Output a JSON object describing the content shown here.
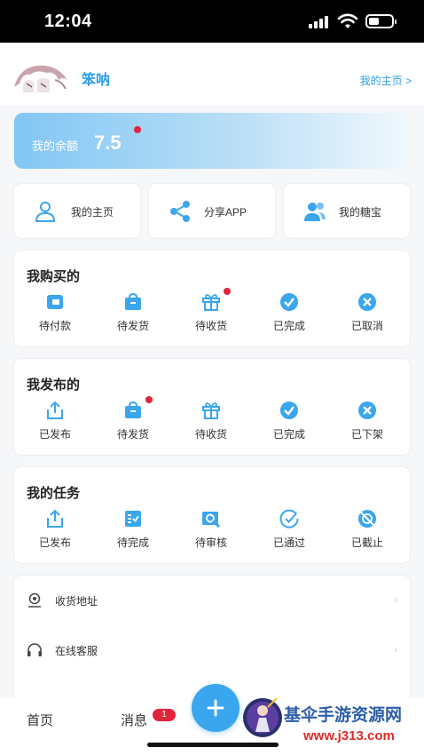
{
  "status_bar": {
    "time": "12:04"
  },
  "profile": {
    "username": "笨呐",
    "home_link": "我的主页 >"
  },
  "balance": {
    "label": "我的余额",
    "value": "7.5"
  },
  "quick_actions": [
    {
      "label": "我的主页",
      "icon": "user-icon"
    },
    {
      "label": "分享APP",
      "icon": "share-icon"
    },
    {
      "label": "我的糖宝",
      "icon": "group-icon"
    }
  ],
  "purchased": {
    "title": "我购买的",
    "items": [
      {
        "label": "待付款",
        "icon": "wallet-icon"
      },
      {
        "label": "待发货",
        "icon": "bag-icon"
      },
      {
        "label": "待收货",
        "icon": "gift-icon"
      },
      {
        "label": "已完成",
        "icon": "check-circle-icon"
      },
      {
        "label": "已取消",
        "icon": "x-circle-icon"
      }
    ]
  },
  "published": {
    "title": "我发布的",
    "items": [
      {
        "label": "已发布",
        "icon": "upload-icon"
      },
      {
        "label": "待发货",
        "icon": "bag-icon"
      },
      {
        "label": "待收货",
        "icon": "gift-icon"
      },
      {
        "label": "已完成",
        "icon": "check-circle-icon"
      },
      {
        "label": "已下架",
        "icon": "x-circle-icon"
      }
    ]
  },
  "tasks": {
    "title": "我的任务",
    "items": [
      {
        "label": "已发布",
        "icon": "upload-icon"
      },
      {
        "label": "待完成",
        "icon": "checklist-icon"
      },
      {
        "label": "待审核",
        "icon": "search-icon"
      },
      {
        "label": "已通过",
        "icon": "check-outline-icon"
      },
      {
        "label": "已截止",
        "icon": "blocked-icon"
      }
    ]
  },
  "settings_list": [
    {
      "label": "收货地址",
      "icon": "location-icon"
    },
    {
      "label": "在线客服",
      "icon": "headset-icon"
    }
  ],
  "tabbar": {
    "home": "首页",
    "messages": "消息",
    "messages_badge": "1"
  },
  "watermark": {
    "title": "基伞手游资源网",
    "url": "www.j313.com"
  },
  "colors": {
    "accent": "#3aa6ee",
    "badge": "#e0243a",
    "link": "#2d9ee8"
  }
}
